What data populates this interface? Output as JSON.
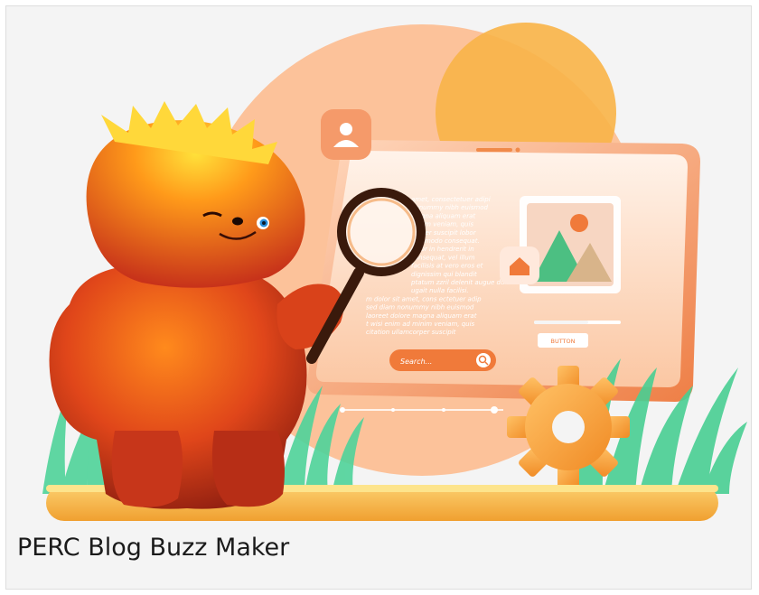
{
  "card": {
    "caption": "PERC Blog Buzz Maker"
  },
  "illustration": {
    "search_placeholder": "Search...",
    "button_label": "BUTTON",
    "body_text_lines": [
      "amet, consectetuer adipi",
      "nonummy nibh euismod",
      "magna aliquam erat",
      "minim veniam, quis",
      "corper suscipit lobor",
      "commodo consequat.",
      "dolor in hendrerit in",
      "consequat, vel illum",
      "facilisis at vero eros et",
      "dignissim qui blandit",
      "ptatum zzril delenit augue duis",
      "ugait nulla facilisi.",
      "m dolor sit amet, cons ectetuer adip",
      "sed diam nonummy nibh euismod",
      "laoreet dolore magna aliquam erat",
      "t wisi enim ad minim veniam, quis",
      "citation ullamcorper suscipit"
    ],
    "icons": [
      "user-icon",
      "search-icon",
      "home-icon",
      "image-icon",
      "gear-icon",
      "magnifying-glass-icon"
    ],
    "colors": {
      "accent": "#f07a3a",
      "sun": "#f8b24a",
      "grass": "#3fc98f",
      "ground": "#f7b14a",
      "card_bg": "#f4f4f4"
    }
  }
}
